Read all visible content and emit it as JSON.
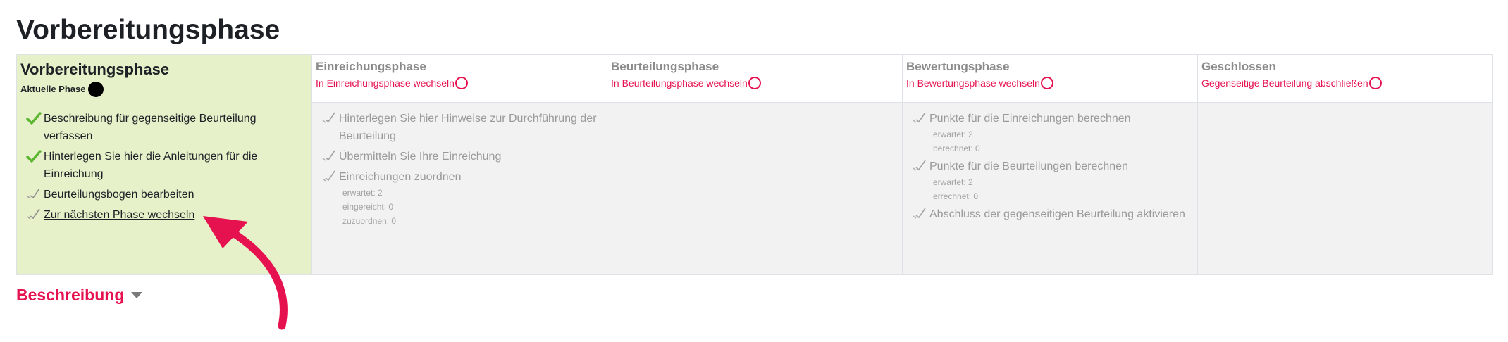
{
  "page_title": "Vorbereitungsphase",
  "colors": {
    "accent": "#e6124f",
    "active_phase_bg": "#e6f0c9",
    "check_green": "#5cb531"
  },
  "phases": [
    {
      "title": "Vorbereitungsphase",
      "current_label": "Aktuelle Phase",
      "tasks": [
        {
          "text": "Beschreibung für gegenseitige Beurteilung verfassen",
          "icon": "check-green-icon"
        },
        {
          "text": "Hinterlegen Sie hier die Anleitungen für die Einreichung",
          "icon": "check-green-icon"
        },
        {
          "text": "Beurteilungsbogen bearbeiten",
          "icon": "check-todo-icon"
        },
        {
          "text": "Zur nächsten Phase wechseln",
          "icon": "check-todo-icon",
          "link": true
        }
      ]
    },
    {
      "title": "Einreichungsphase",
      "switch_label": "In Einreichungsphase wechseln",
      "tasks": [
        {
          "text": "Hinterlegen Sie hier Hinweise zur Durchführung der Beurteilung",
          "icon": "check-todo-icon"
        },
        {
          "text": "Übermitteln Sie Ihre Einreichung",
          "icon": "check-todo-icon"
        },
        {
          "text": "Einreichungen zuordnen",
          "icon": "check-todo-icon",
          "details": [
            "erwartet: 2",
            "eingereicht: 0",
            "zuzuordnen: 0"
          ]
        }
      ]
    },
    {
      "title": "Beurteilungsphase",
      "switch_label": "In Beurteilungsphase wechseln",
      "tasks": []
    },
    {
      "title": "Bewertungsphase",
      "switch_label": "In Bewertungsphase wechseln",
      "tasks": [
        {
          "text": "Punkte für die Einreichungen berechnen",
          "icon": "check-todo-icon",
          "details": [
            "erwartet: 2",
            "berechnet: 0"
          ]
        },
        {
          "text": "Punkte für die Beurteilungen berechnen",
          "icon": "check-todo-icon",
          "details": [
            "erwartet: 2",
            "errechnet: 0"
          ]
        },
        {
          "text": "Abschluss der gegenseitigen Beurteilung aktivieren",
          "icon": "check-todo-icon"
        }
      ]
    },
    {
      "title": "Geschlossen",
      "switch_label": "Gegenseitige Beurteilung abschließen",
      "tasks": []
    }
  ],
  "description_heading": "Beschreibung"
}
